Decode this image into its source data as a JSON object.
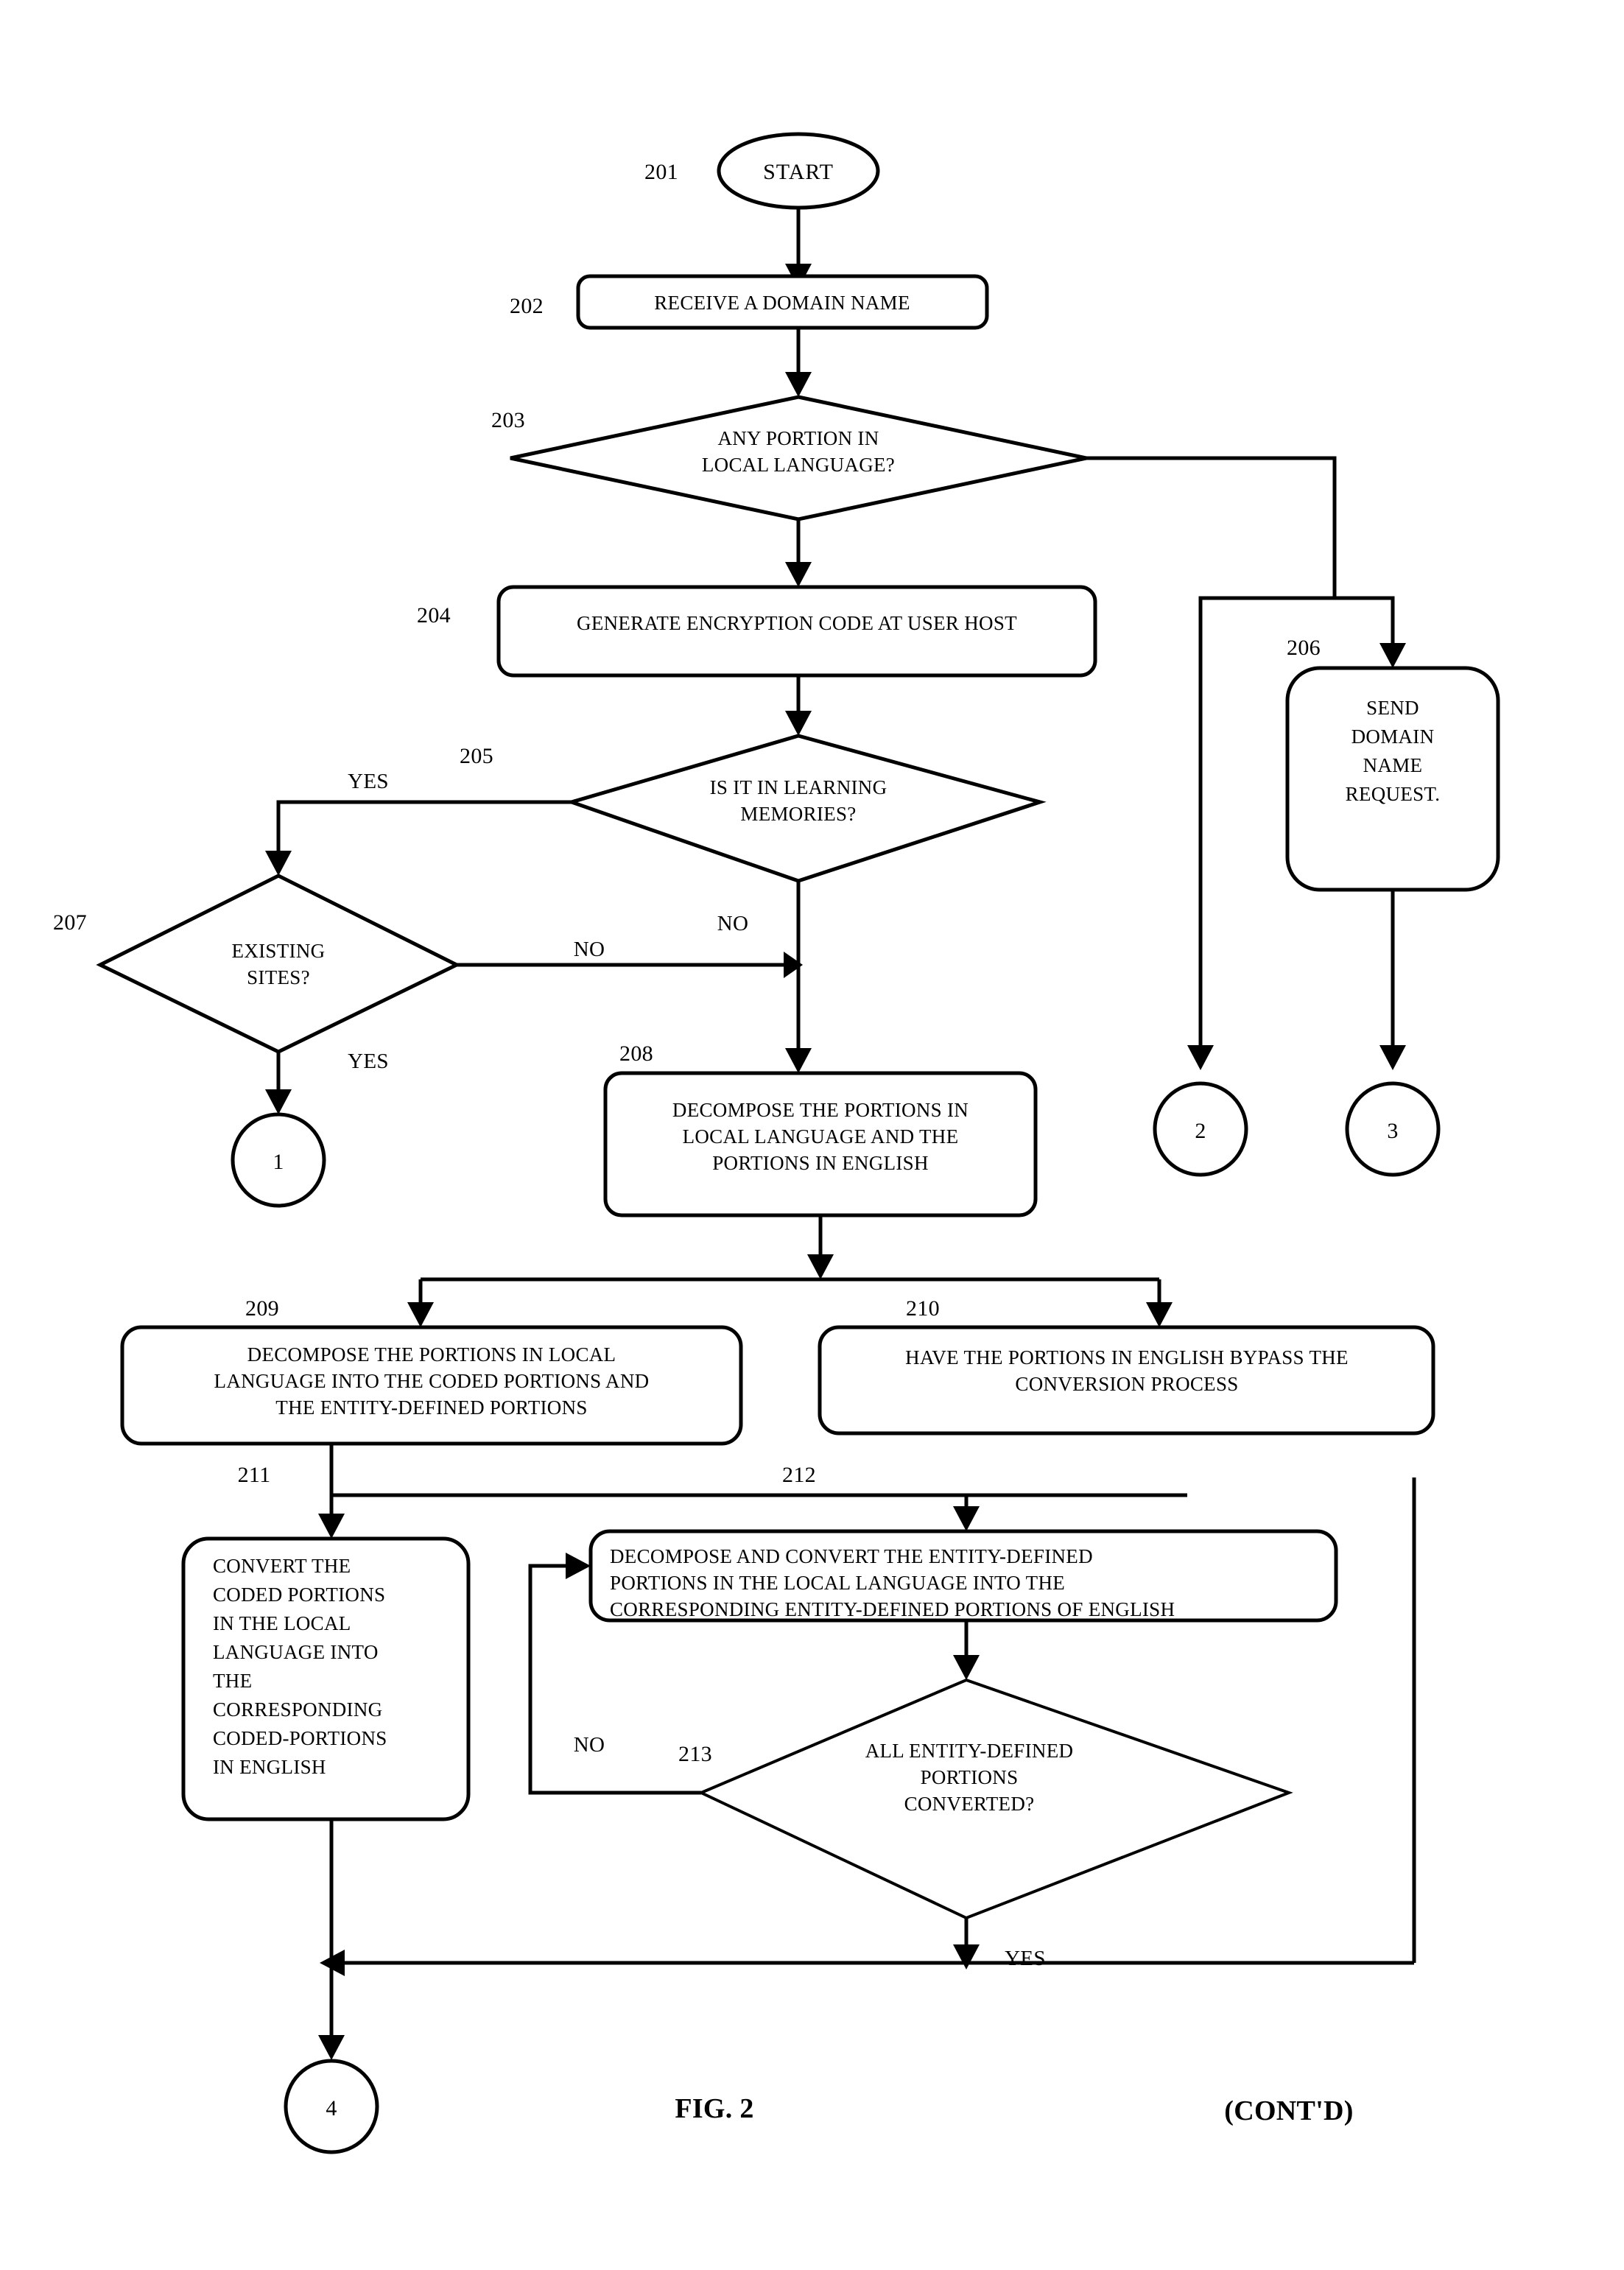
{
  "figure": {
    "caption": "FIG. 2",
    "continuation": "(CONT'D)"
  },
  "nodes": {
    "start": {
      "ref": "201",
      "label": "START",
      "shape": "ellipse"
    },
    "n202": {
      "ref": "202",
      "lines": [
        "RECEIVE A DOMAIN NAME"
      ],
      "shape": "rounded-rect"
    },
    "n203": {
      "ref": "203",
      "lines": [
        "ANY PORTION IN",
        "LOCAL LANGUAGE?"
      ],
      "shape": "diamond"
    },
    "n204": {
      "ref": "204",
      "lines": [
        "GENERATE ENCRYPTION CODE AT USER HOST"
      ],
      "shape": "rounded-rect"
    },
    "n205": {
      "ref": "205",
      "lines": [
        "IS IT IN LEARNING",
        "MEMORIES?"
      ],
      "shape": "diamond"
    },
    "n206": {
      "ref": "206",
      "lines": [
        "SEND",
        "DOMAIN",
        "NAME",
        "REQUEST."
      ],
      "shape": "rounded-rect"
    },
    "n207": {
      "ref": "207",
      "lines": [
        "EXISTING",
        "SITES?"
      ],
      "shape": "diamond"
    },
    "n208": {
      "ref": "208",
      "lines": [
        "DECOMPOSE THE PORTIONS IN",
        "LOCAL LANGUAGE AND THE",
        "PORTIONS IN ENGLISH"
      ],
      "shape": "rounded-rect"
    },
    "n209": {
      "ref": "209",
      "lines": [
        "DECOMPOSE THE PORTIONS IN LOCAL",
        "LANGUAGE INTO THE CODED PORTIONS AND",
        "THE ENTITY-DEFINED PORTIONS"
      ],
      "shape": "rounded-rect"
    },
    "n210": {
      "ref": "210",
      "lines": [
        "HAVE THE PORTIONS IN ENGLISH BYPASS THE",
        "CONVERSION PROCESS"
      ],
      "shape": "rounded-rect"
    },
    "n211": {
      "ref": "211",
      "lines": [
        "CONVERT THE",
        "CODED PORTIONS",
        "IN THE LOCAL",
        "LANGUAGE INTO",
        "THE",
        "CORRESPONDING",
        "CODED-PORTIONS",
        "IN ENGLISH"
      ],
      "shape": "rounded-rect"
    },
    "n212": {
      "ref": "212",
      "lines": [
        "DECOMPOSE AND CONVERT THE ENTITY-DEFINED",
        "PORTIONS IN THE LOCAL LANGUAGE INTO THE",
        "CORRESPONDING ENTITY-DEFINED PORTIONS OF ENGLISH"
      ],
      "shape": "rounded-rect"
    },
    "n213": {
      "ref": "213",
      "lines": [
        "ALL ENTITY-DEFINED",
        "PORTIONS",
        "CONVERTED?"
      ],
      "shape": "diamond"
    }
  },
  "connectors": {
    "c1": {
      "label": "1"
    },
    "c2": {
      "label": "2"
    },
    "c3": {
      "label": "3"
    },
    "c4": {
      "label": "4"
    }
  },
  "edge_labels": {
    "e205_yes": "YES",
    "e205_no": "NO",
    "e207_no": "NO",
    "e207_yes": "YES",
    "e208_no": "NO",
    "e213_no": "NO",
    "e213_yes": "YES"
  },
  "colors": {
    "stroke": "#000000",
    "fill": "#ffffff",
    "text": "#000000"
  }
}
